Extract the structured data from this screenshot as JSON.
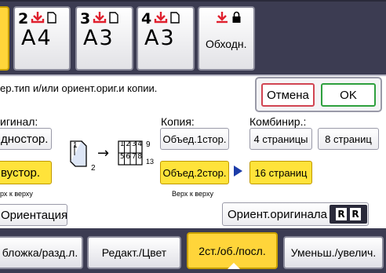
{
  "trays": [
    {
      "number": "",
      "paper": "",
      "selected": true
    },
    {
      "number": "2",
      "paper": "A4",
      "selected": false
    },
    {
      "number": "3",
      "paper": "A3",
      "selected": false
    },
    {
      "number": "4",
      "paper": "A3",
      "selected": false
    }
  ],
  "bypass": {
    "label": "Обходн."
  },
  "dialog": {
    "instruction": "ер.тип и/или ориент.ориг.и копии.",
    "cancel_label": "Отмена",
    "ok_label": "OK"
  },
  "original": {
    "label": "игинал:",
    "one_sided_label": "дностор.",
    "two_sided_label": "вустор.",
    "top_to_top": "рх к верху",
    "orientation_label": "Ориентация"
  },
  "copy": {
    "label": "Копия:",
    "combine1_label": "Объед.1стор.",
    "combine2_label": "Объед.2стор.",
    "top_to_top": "Верх к верху"
  },
  "combine": {
    "label": "Комбинир.:",
    "pages4_label": "4 страницы",
    "pages8_label": "8 страниц",
    "pages16_label": "16 страниц"
  },
  "orig_orientation": {
    "label": "Ориент.оригинала",
    "icon_letters": [
      "R",
      "R"
    ]
  },
  "diagram": {
    "original_pages": "1",
    "original_pages_bottom": "2",
    "copy_cells_top": [
      "1",
      "2",
      "3",
      "4"
    ],
    "copy_cells_bottom": [
      "5",
      "6",
      "7",
      "8"
    ],
    "copy_side_top": "9",
    "copy_side_bottom": "13"
  },
  "tabs": [
    {
      "label": "бложка/разд.л.",
      "selected": false
    },
    {
      "label": "Редакт./Цвет",
      "selected": false
    },
    {
      "label": "2ст./об./посл.",
      "selected": true
    },
    {
      "label": "Уменьш./увелич.",
      "selected": false
    }
  ],
  "colors": {
    "selected_yellow": "#ffd53a",
    "tray_icon_red": "#e0202e",
    "ok_green": "#2ea03e",
    "cancel_red": "#d14552",
    "panel_dark": "#3c3c52"
  }
}
